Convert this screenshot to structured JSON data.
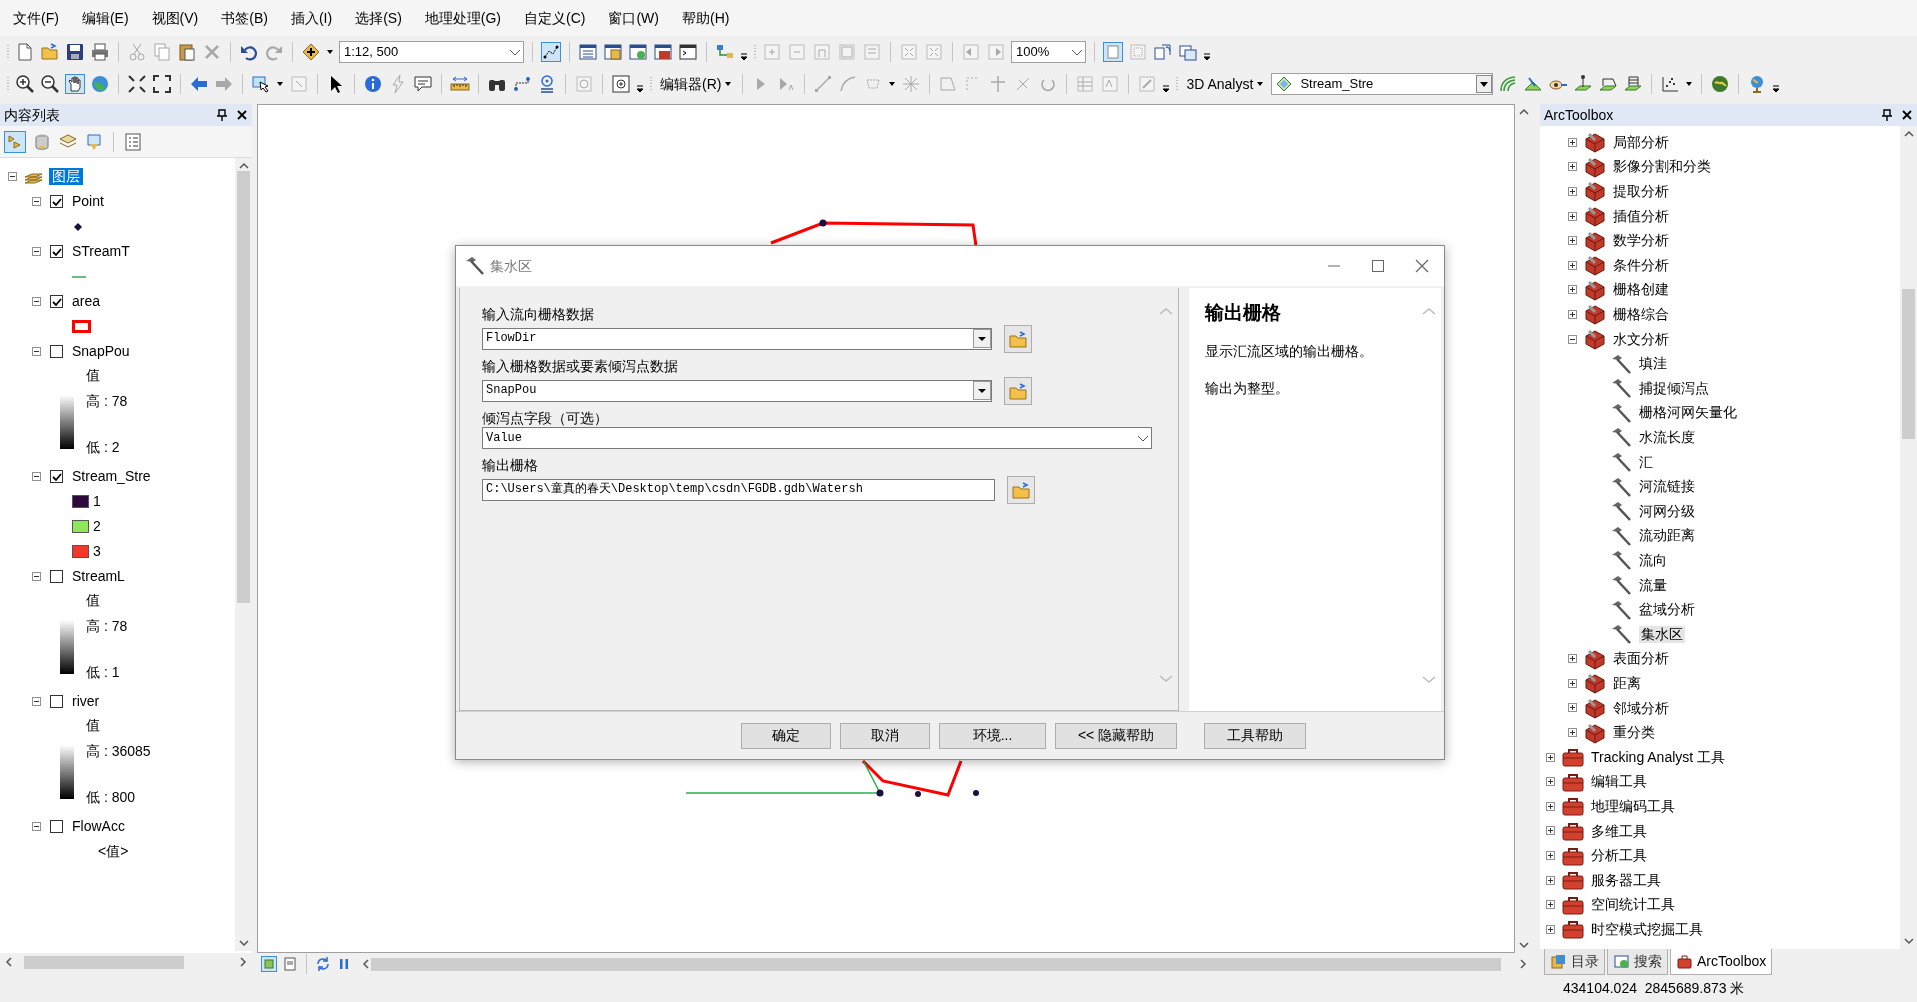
{
  "menu_bar": [
    "文件(F)",
    "编辑(E)",
    "视图(V)",
    "书签(B)",
    "插入(I)",
    "选择(S)",
    "地理处理(G)",
    "自定义(C)",
    "窗口(W)",
    "帮助(H)"
  ],
  "toolbars": {
    "scale": "1:12, 500",
    "page_zoom": "100%",
    "editor_menu": "编辑器(R)",
    "analyst_menu": "3D Analyst",
    "target_layer": "Stream_Stre"
  },
  "table_of_contents": {
    "title": "内容列表",
    "root": {
      "label": "图层",
      "selected": true,
      "expanded": true
    },
    "layers": [
      {
        "name": "Point",
        "checked": true,
        "expanded": true,
        "legend": {
          "kind": "point"
        }
      },
      {
        "name": "STreamT",
        "checked": true,
        "expanded": true,
        "legend": {
          "kind": "line"
        }
      },
      {
        "name": "area",
        "checked": true,
        "expanded": true,
        "legend": {
          "kind": "polygon"
        }
      },
      {
        "name": "SnapPou",
        "checked": false,
        "expanded": true,
        "legend": {
          "kind": "stretch",
          "heading": "值",
          "high": "高 : 78",
          "low": "低 : 2"
        }
      },
      {
        "name": "Stream_Stre",
        "checked": true,
        "expanded": true,
        "legend": {
          "kind": "classes",
          "classes": [
            {
              "label": "1",
              "color": "#2e0a3c"
            },
            {
              "label": "2",
              "color": "#8fe65a"
            },
            {
              "label": "3",
              "color": "#f2382a"
            }
          ]
        }
      },
      {
        "name": "StreamL",
        "checked": false,
        "expanded": true,
        "legend": {
          "kind": "stretch",
          "heading": "值",
          "high": "高 : 78",
          "low": "低 : 1"
        }
      },
      {
        "name": "river",
        "checked": false,
        "expanded": true,
        "legend": {
          "kind": "stretch",
          "heading": "值",
          "high": "高 : 36085",
          "low": "低 : 800"
        }
      },
      {
        "name": "FlowAcc",
        "checked": false,
        "expanded": true,
        "legend": {
          "kind": "heading",
          "heading": "<值>"
        }
      }
    ]
  },
  "dialog": {
    "title": "集水区",
    "fields": [
      {
        "label": "输入流向栅格数据",
        "value": "FlowDir",
        "kind": "combo_browse"
      },
      {
        "label": "输入栅格数据或要素倾泻点数据",
        "value": "SnapPou",
        "kind": "combo_browse"
      },
      {
        "label": "倾泻点字段（可选）",
        "value": "Value",
        "kind": "dropdown"
      },
      {
        "label": "输出栅格",
        "value": "C:\\Users\\童真的春天\\Desktop\\temp\\csdn\\FGDB.gdb\\Watersh",
        "kind": "text_browse"
      }
    ],
    "help": {
      "title": "输出栅格",
      "paragraphs": [
        "显示汇流区域的输出栅格。",
        "输出为整型。"
      ]
    },
    "buttons": [
      "确定",
      "取消",
      "环境...",
      "<< 隐藏帮助",
      "工具帮助"
    ]
  },
  "toolbox": {
    "title": "ArcToolbox",
    "nested_items": [
      {
        "label": "局部分析",
        "kind": "toolset",
        "expanded": false
      },
      {
        "label": "影像分割和分类",
        "kind": "toolset",
        "expanded": false
      },
      {
        "label": "提取分析",
        "kind": "toolset",
        "expanded": false
      },
      {
        "label": "插值分析",
        "kind": "toolset",
        "expanded": false
      },
      {
        "label": "数学分析",
        "kind": "toolset",
        "expanded": false
      },
      {
        "label": "条件分析",
        "kind": "toolset",
        "expanded": false
      },
      {
        "label": "栅格创建",
        "kind": "toolset",
        "expanded": false
      },
      {
        "label": "栅格综合",
        "kind": "toolset",
        "expanded": false
      },
      {
        "label": "水文分析",
        "kind": "toolset",
        "expanded": true,
        "children": [
          {
            "label": "填洼",
            "kind": "tool",
            "selected": false
          },
          {
            "label": "捕捉倾泻点",
            "kind": "tool",
            "selected": false
          },
          {
            "label": "栅格河网矢量化",
            "kind": "tool",
            "selected": false
          },
          {
            "label": "水流长度",
            "kind": "tool",
            "selected": false
          },
          {
            "label": "汇",
            "kind": "tool",
            "selected": false
          },
          {
            "label": "河流链接",
            "kind": "tool",
            "selected": false
          },
          {
            "label": "河网分级",
            "kind": "tool",
            "selected": false
          },
          {
            "label": "流动距离",
            "kind": "tool",
            "selected": false
          },
          {
            "label": "流向",
            "kind": "tool",
            "selected": false
          },
          {
            "label": "流量",
            "kind": "tool",
            "selected": false
          },
          {
            "label": "盆域分析",
            "kind": "tool",
            "selected": false
          },
          {
            "label": "集水区",
            "kind": "tool",
            "selected": true
          }
        ]
      },
      {
        "label": "表面分析",
        "kind": "toolset",
        "expanded": false
      },
      {
        "label": "距离",
        "kind": "toolset",
        "expanded": false
      },
      {
        "label": "邻域分析",
        "kind": "toolset",
        "expanded": false
      },
      {
        "label": "重分类",
        "kind": "toolset",
        "expanded": false
      }
    ],
    "items": [
      {
        "label": "Tracking Analyst 工具",
        "kind": "toolbox",
        "expanded": false
      },
      {
        "label": "编辑工具",
        "kind": "toolbox",
        "expanded": false
      },
      {
        "label": "地理编码工具",
        "kind": "toolbox",
        "expanded": false
      },
      {
        "label": "多维工具",
        "kind": "toolbox",
        "expanded": false
      },
      {
        "label": "分析工具",
        "kind": "toolbox",
        "expanded": false
      },
      {
        "label": "服务器工具",
        "kind": "toolbox",
        "expanded": false
      },
      {
        "label": "空间统计工具",
        "kind": "toolbox",
        "expanded": false
      },
      {
        "label": "时空模式挖掘工具",
        "kind": "toolbox",
        "expanded": false
      }
    ],
    "tabs": [
      {
        "label": "目录",
        "selected": false
      },
      {
        "label": "搜索",
        "selected": false
      },
      {
        "label": "ArcToolbox",
        "selected": true
      }
    ]
  },
  "status_bar": {
    "coordinates": "434104.024  2845689.873 米"
  }
}
